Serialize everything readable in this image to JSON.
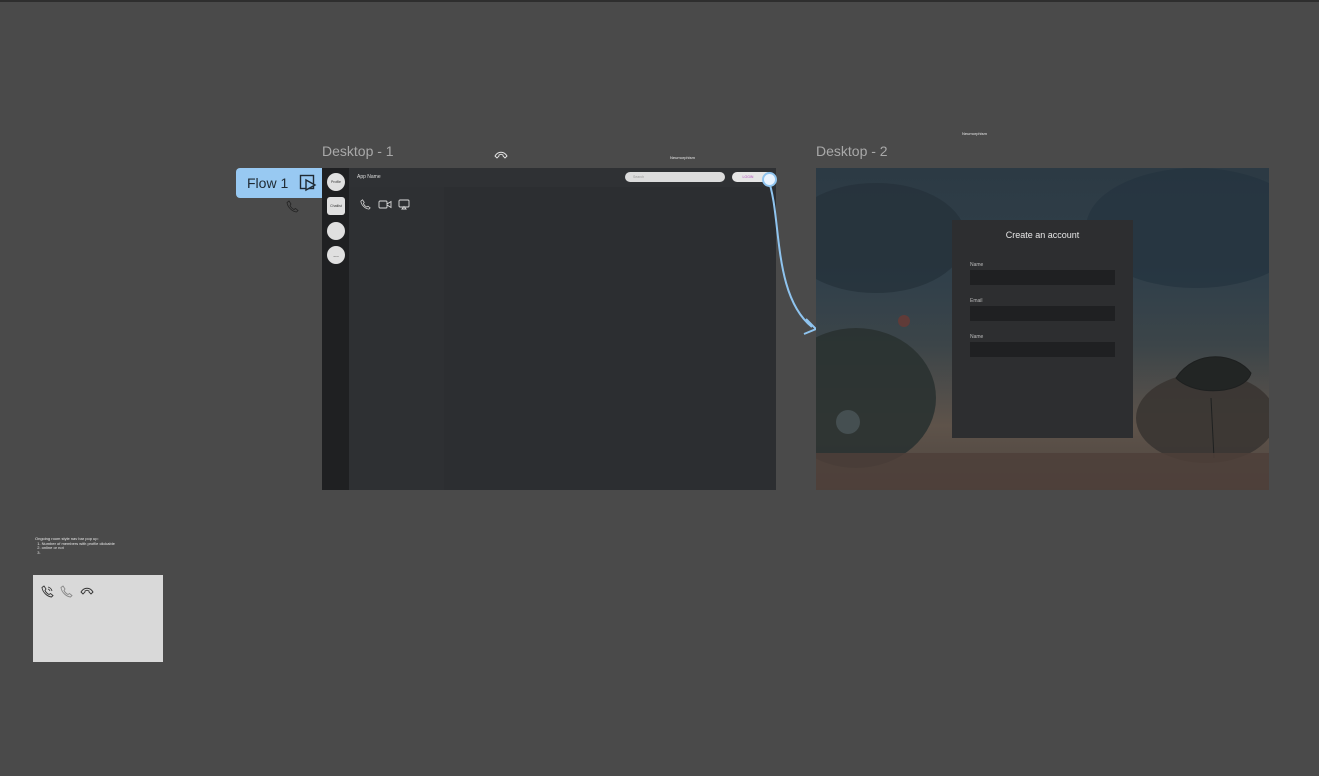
{
  "canvas": {
    "frame1_title": "Desktop - 1",
    "frame2_title": "Desktop - 2",
    "label_neumorphism_1": "Neumorphism",
    "label_neumorphism_2": "Neumorphism"
  },
  "flow": {
    "label": "Flow 1"
  },
  "desktop1": {
    "app_name": "App Name",
    "search_placeholder": "Search",
    "login_label": "LOGIN",
    "rail_items": [
      "Profile",
      "Chatlist",
      "",
      "..."
    ]
  },
  "desktop2": {
    "card_title": "Create an account",
    "fields": [
      {
        "label": "Name",
        "value": ""
      },
      {
        "label": "Email",
        "value": ""
      },
      {
        "label": "Name",
        "value": ""
      }
    ]
  },
  "notes": {
    "text": "Ongoing room style nav bar pop up:\n  1. Number of members with profile clickable\n  2. online or not\n  3."
  },
  "colors": {
    "canvas_bg": "#4a4a4a",
    "flow_accent": "#98c9f2",
    "connector": "#8fc4ef",
    "login_text": "#b04dbd"
  }
}
